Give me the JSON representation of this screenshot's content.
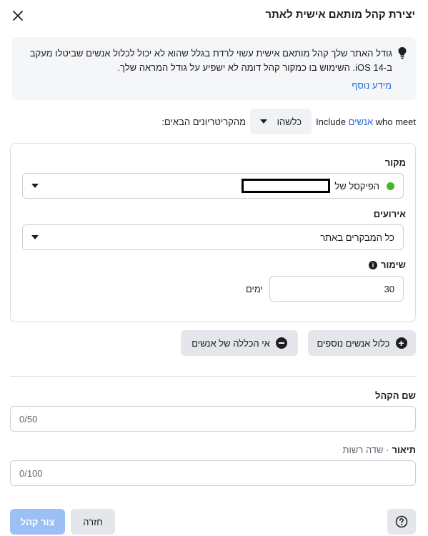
{
  "dialog": {
    "title": "יצירת קהל מותאם אישית לאתר",
    "close_icon": "close-icon"
  },
  "notice": {
    "text": "גודל האתר שלך קהל מותאם אישית עשוי לרדת בגלל שהוא לא יכול לכלול אנשים שביטלו מעקב ב-iOS 14. השימוש בו כמקור קהל דומה לא ישפיע על גודל המראה שלך.",
    "link": "מידע נוסף",
    "icon": "lightbulb-icon"
  },
  "include_row": {
    "include": "Include",
    "people": "אנשים",
    "who_meet": "who meet",
    "match_dropdown": "כלשהו",
    "criteria": "מהקריטריונים הבאים:"
  },
  "source": {
    "label": "מקור",
    "value": "הפיקסל של",
    "status_color": "#42b72a"
  },
  "events": {
    "label": "אירועים",
    "value": "כל המבקרים באתר"
  },
  "retention": {
    "label": "שימור",
    "value": "30",
    "unit": "ימים"
  },
  "actions": {
    "include_more": "כלול אנשים נוספים",
    "exclude": "אי הכללה של אנשים"
  },
  "audience_name": {
    "label": "שם הקהל",
    "counter": "0/50"
  },
  "description": {
    "label": "תיאור",
    "optional": "· שדה רשות",
    "counter": "0/100"
  },
  "footer": {
    "create": "צור קהל",
    "back": "חזרה",
    "help_icon": "help-icon"
  },
  "colors": {
    "link": "#216fdb",
    "primary_disabled": "#9cc0f3"
  }
}
